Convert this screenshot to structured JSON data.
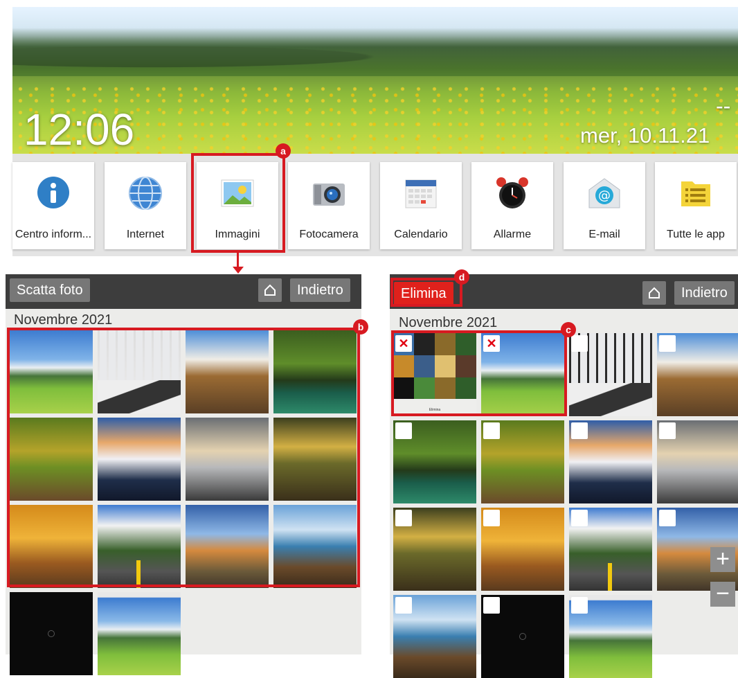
{
  "home": {
    "clock": "12:06",
    "date_extra": "--",
    "date": "mer, 10.11.21"
  },
  "apps": [
    {
      "label": "Centro inform...",
      "icon": "info-icon"
    },
    {
      "label": "Internet",
      "icon": "globe-icon"
    },
    {
      "label": "Immagini",
      "icon": "pictures-icon"
    },
    {
      "label": "Fotocamera",
      "icon": "camera-icon"
    },
    {
      "label": "Calendario",
      "icon": "calendar-icon"
    },
    {
      "label": "Allarme",
      "icon": "alarm-clock-icon"
    },
    {
      "label": "E-mail",
      "icon": "email-icon"
    },
    {
      "label": "Tutte le app",
      "icon": "all-apps-icon"
    }
  ],
  "gallery_left": {
    "action_label": "Scatta foto",
    "back_label": "Indietro",
    "month": "Novembre 2021"
  },
  "gallery_right": {
    "action_label": "Elimina",
    "back_label": "Indietro",
    "month": "Novembre 2021",
    "thumbnail_caption": "Elimina"
  },
  "zoom": {
    "plus": "+",
    "minus": "−"
  },
  "annotations": {
    "a": "a",
    "b": "b",
    "c": "c",
    "d": "d"
  },
  "colors": {
    "highlight": "#d71a21",
    "bar": "#3d3d3d",
    "button": "#777777",
    "delete_button": "#e0211c"
  }
}
